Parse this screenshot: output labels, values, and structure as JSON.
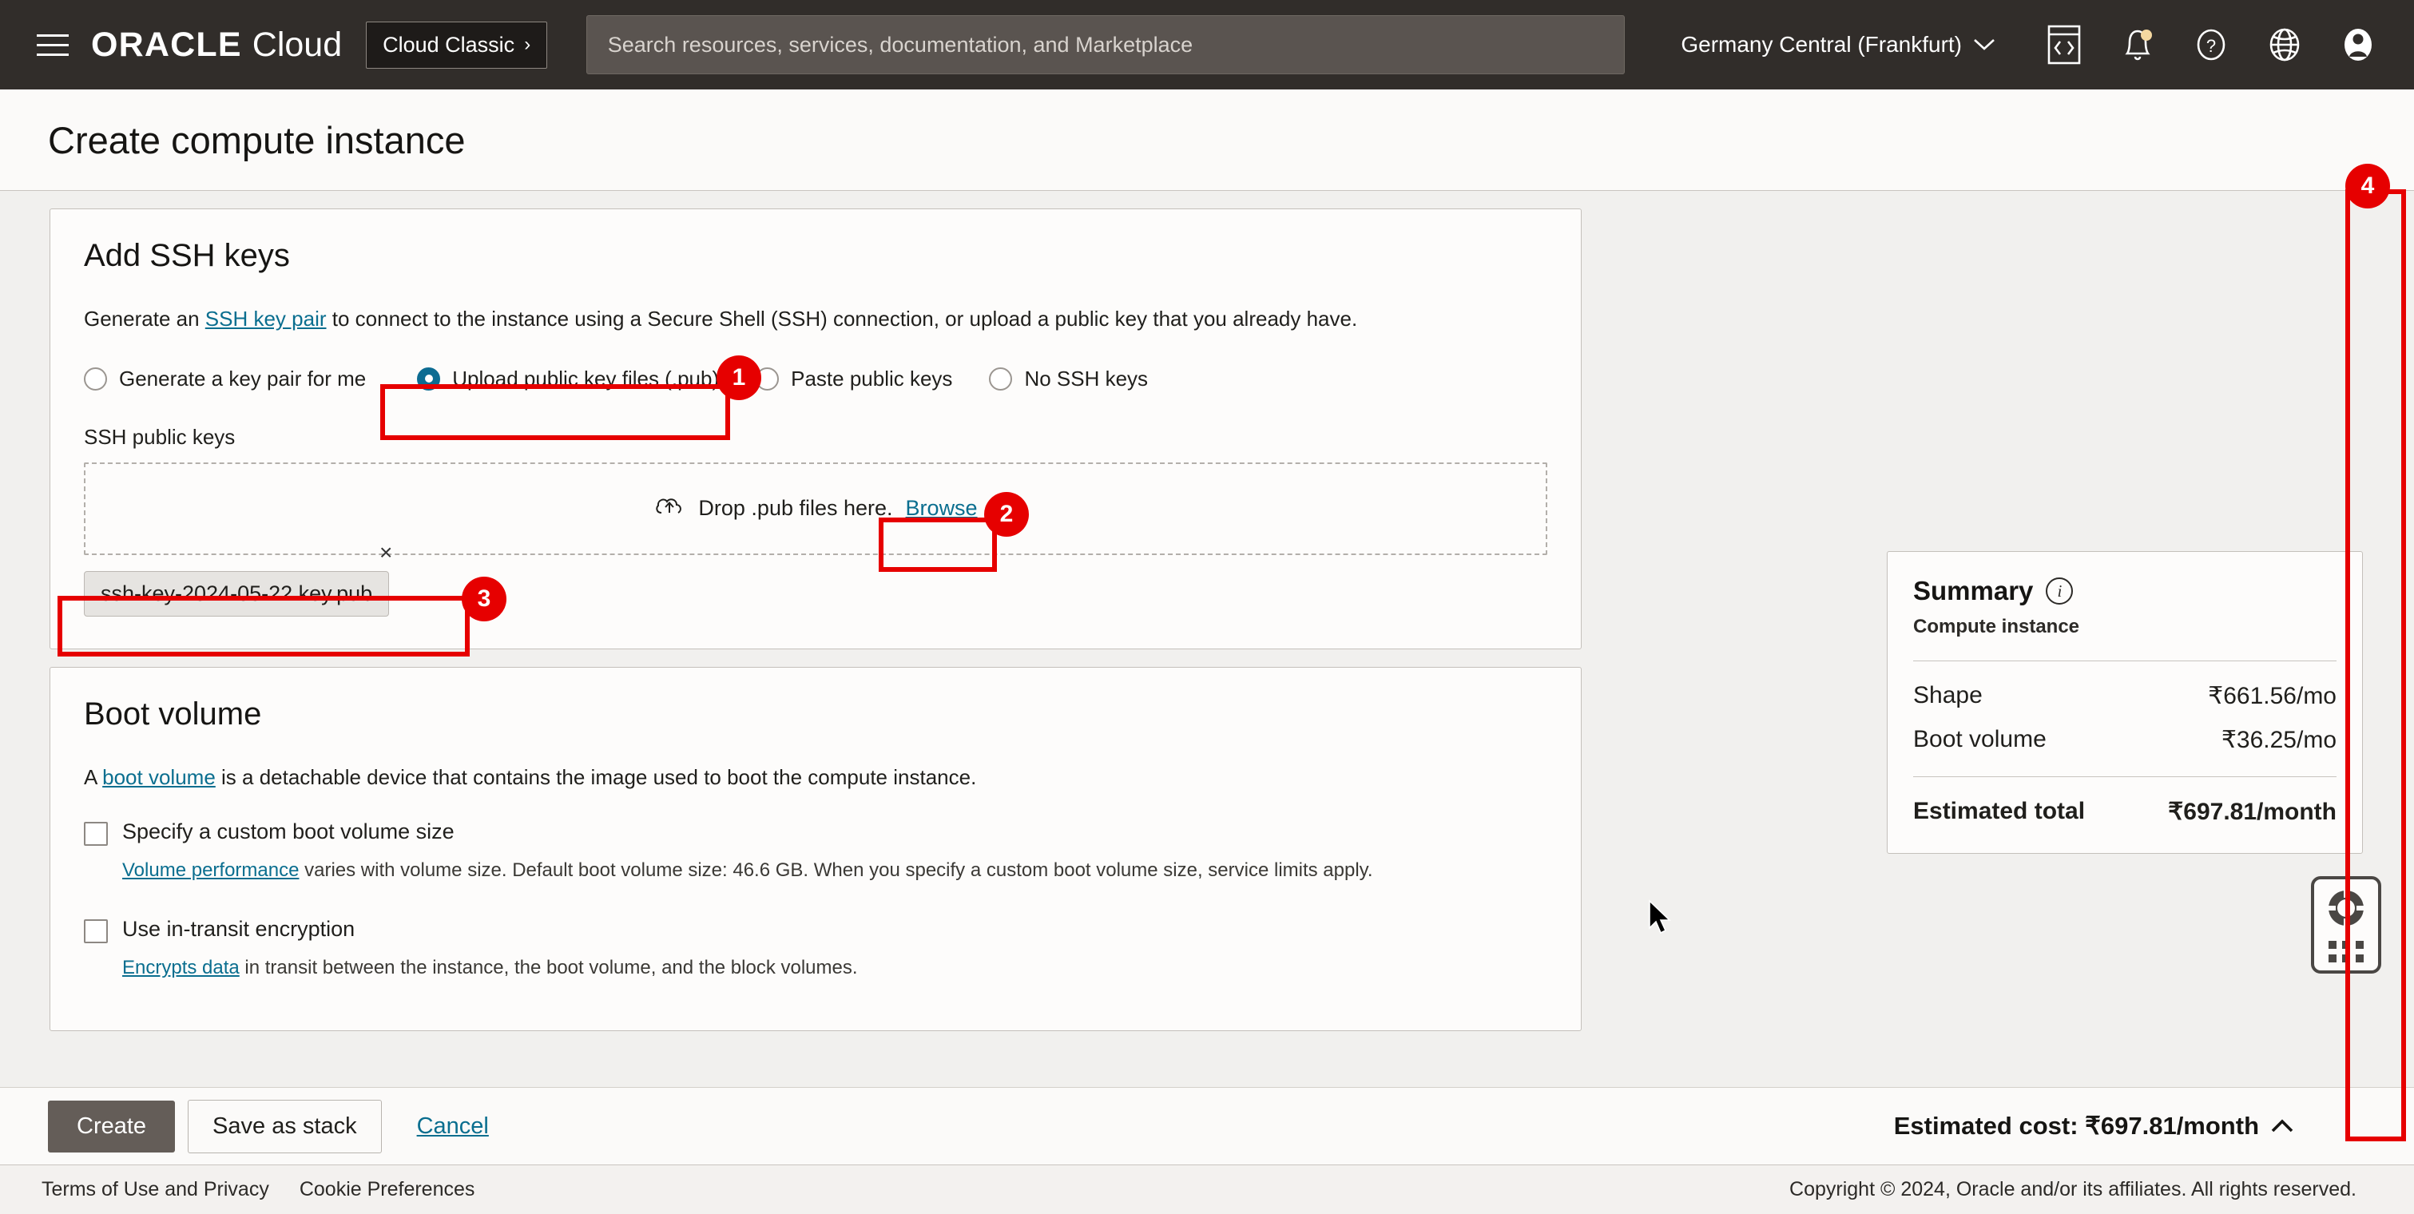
{
  "topnav": {
    "menu_icon": "hamburger-menu-icon",
    "brand_oracle": "ORACLE",
    "brand_cloud": "Cloud",
    "cloud_classic_label": "Cloud Classic",
    "cloud_classic_chevron": "›",
    "search_placeholder": "Search resources, services, documentation, and Marketplace",
    "search_value": "",
    "region": "Germany Central (Frankfurt)",
    "region_chevron": "∨",
    "icons": [
      "cloud-shell-icon",
      "notifications-bell-icon",
      "help-question-icon",
      "language-globe-icon",
      "user-avatar-icon"
    ]
  },
  "page": {
    "title": "Create compute instance"
  },
  "ssh_card": {
    "heading": "Add SSH keys",
    "desc_before": "Generate an ",
    "desc_link": "SSH key pair",
    "desc_after": " to connect to the instance using a Secure Shell (SSH) connection, or upload a public key that you already have.",
    "options": [
      {
        "label": "Generate a key pair for me",
        "selected": false
      },
      {
        "label": "Upload public key files (.pub)",
        "selected": true
      },
      {
        "label": "Paste public keys",
        "selected": false
      },
      {
        "label": "No SSH keys",
        "selected": false
      }
    ],
    "field_label": "SSH public keys",
    "dropzone_icon": "cloud-upload-icon",
    "dropzone_text": "Drop .pub files here.",
    "browse_label": "Browse",
    "remove_icon": "×",
    "uploaded_file": "ssh-key-2024-05-22.key.pub"
  },
  "boot_card": {
    "heading": "Boot volume",
    "desc_before": "A ",
    "desc_link": "boot volume",
    "desc_after": " is a detachable device that contains the image used to boot the compute instance.",
    "checkboxes": [
      {
        "label": "Specify a custom boot volume size",
        "checked": false,
        "note_link": "Volume performance",
        "note_text": " varies with volume size. Default boot volume size: 46.6 GB. When you specify a custom boot volume size, service limits apply."
      },
      {
        "label": "Use in-transit encryption",
        "checked": false,
        "note_link": "Encrypts data",
        "note_text": " in transit between the instance, the boot volume, and the block volumes."
      }
    ]
  },
  "summary": {
    "title": "Summary",
    "info_icon": "info-circle-icon",
    "subtitle": "Compute instance",
    "rows": [
      {
        "label": "Shape",
        "value": "₹661.56/mo"
      },
      {
        "label": "Boot volume",
        "value": "₹36.25/mo"
      }
    ],
    "total_label": "Estimated total",
    "total_value": "₹697.81/month"
  },
  "support_widget": {
    "icon": "life-preserver-support-icon",
    "handle": "drag-handle-dots"
  },
  "actionbar": {
    "create_label": "Create",
    "save_stack_label": "Save as stack",
    "cancel_label": "Cancel",
    "estimated_cost": "Estimated cost: ₹697.81/month",
    "collapse_chevron": "∧"
  },
  "footer": {
    "terms": "Terms of Use and Privacy",
    "cookies": "Cookie Preferences",
    "copyright": "Copyright © 2024, Oracle and/or its affiliates. All rights reserved."
  },
  "annotations": {
    "markers": [
      "1",
      "2",
      "3",
      "4"
    ],
    "color": "#e60000"
  }
}
